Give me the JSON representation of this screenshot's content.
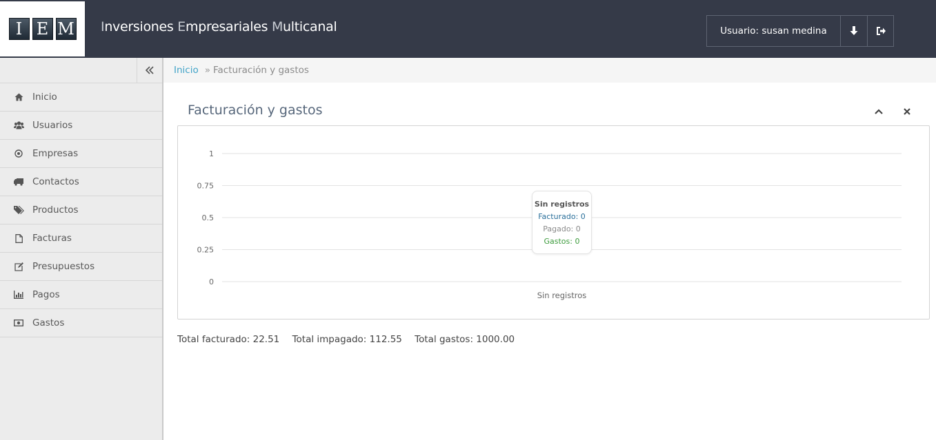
{
  "header": {
    "logo_letters": [
      "I",
      "E",
      "M"
    ],
    "title_parts": [
      {
        "initial": "I",
        "rest": "nversiones "
      },
      {
        "initial": "E",
        "rest": "mpresariales "
      },
      {
        "initial": "M",
        "rest": "ulticanal"
      }
    ],
    "user_label": "Usuario: susan medina",
    "download_icon": "arrow-down-icon",
    "logout_icon": "sign-out-icon"
  },
  "sidebar": {
    "collapse_icon": "double-chevron-left-icon",
    "items": [
      {
        "label": "Inicio",
        "icon": "home-icon"
      },
      {
        "label": "Usuarios",
        "icon": "users-icon"
      },
      {
        "label": "Empresas",
        "icon": "dot-circle-icon"
      },
      {
        "label": "Contactos",
        "icon": "truck-icon"
      },
      {
        "label": "Productos",
        "icon": "tags-icon"
      },
      {
        "label": "Facturas",
        "icon": "file-icon"
      },
      {
        "label": "Presupuestos",
        "icon": "edit-icon"
      },
      {
        "label": "Pagos",
        "icon": "bar-chart-icon"
      },
      {
        "label": "Gastos",
        "icon": "money-icon"
      }
    ]
  },
  "breadcrumb": {
    "home": "Inicio",
    "separator": "»",
    "current": "Facturación y gastos"
  },
  "panel": {
    "title": "Facturación y gastos",
    "collapse_icon": "chevron-up-icon",
    "close_icon": "close-icon"
  },
  "chart_data": {
    "type": "line",
    "categories": [
      "Sin registros"
    ],
    "series": [
      {
        "name": "Facturado",
        "values": [
          0
        ],
        "color": "#2a6f9a"
      },
      {
        "name": "Pagado",
        "values": [
          0
        ],
        "color": "#8a8a8a"
      },
      {
        "name": "Gastos",
        "values": [
          0
        ],
        "color": "#3a9a3a"
      }
    ],
    "y_ticks": [
      "0",
      "0.25",
      "0.5",
      "0.75",
      "1"
    ],
    "ylim": [
      0,
      1
    ],
    "grid": true,
    "tooltip": {
      "title": "Sin registros",
      "lines": [
        "Facturado: 0",
        "Pagado: 0",
        "Gastos: 0"
      ]
    }
  },
  "totals": {
    "facturado": "Total facturado: 22.51",
    "impagado": "Total impagado: 112.55",
    "gastos": "Total gastos: 1000.00"
  }
}
